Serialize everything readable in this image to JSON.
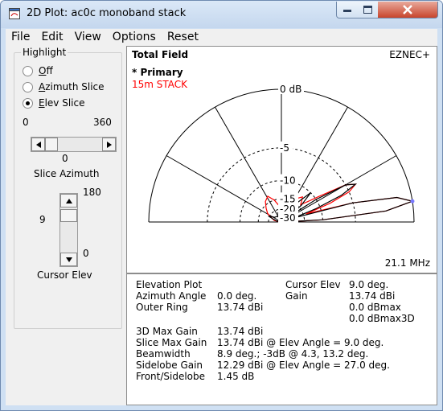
{
  "window": {
    "title": "2D Plot: ac0c monoband stack"
  },
  "menu": [
    "File",
    "Edit",
    "View",
    "Options",
    "Reset"
  ],
  "highlight": {
    "title": "Highlight",
    "options": [
      {
        "label": "Off",
        "underline": "O",
        "rest": "ff",
        "selected": false
      },
      {
        "label": "Azimuth Slice",
        "underline": "A",
        "rest": "zimuth Slice",
        "selected": false
      },
      {
        "label": "Elev Slice",
        "underline": "E",
        "rest": "lev Slice",
        "selected": true
      }
    ]
  },
  "slice_azimuth": {
    "min": "0",
    "max": "360",
    "value": "0",
    "label": "Slice Azimuth",
    "fraction": 0.0
  },
  "cursor_elev": {
    "max": "180",
    "min": "0",
    "value": "9",
    "label": "Cursor Elev",
    "fraction": 0.05
  },
  "plot": {
    "title": "Total Field",
    "brand": "EZNEC+",
    "trace_primary": "* Primary",
    "trace_secondary": "15m STACK",
    "frequency": "21.1 MHz",
    "ring_labels": [
      "0 dB",
      "-5",
      "-10",
      "-15",
      "-20",
      "-30"
    ],
    "colors": {
      "primary": "#000000",
      "secondary": "#ff0000"
    }
  },
  "chart_data": {
    "type": "polar",
    "title": "Total Field",
    "units": "dB",
    "ring_labels": [
      "0 dB",
      "-5",
      "-10",
      "-15",
      "-20",
      "-30"
    ],
    "series": [
      {
        "name": "* Primary",
        "color": "#000000",
        "points": [
          [
            0,
            -40
          ],
          [
            3,
            -10
          ],
          [
            6,
            -2
          ],
          [
            9,
            0
          ],
          [
            12,
            -1
          ],
          [
            15,
            -5
          ],
          [
            18,
            -20
          ],
          [
            21,
            -11
          ],
          [
            24,
            -6
          ],
          [
            27,
            -4
          ],
          [
            30,
            -5
          ],
          [
            33,
            -10
          ],
          [
            36,
            -25
          ],
          [
            40,
            -14
          ],
          [
            45,
            -10
          ],
          [
            50,
            -14
          ],
          [
            55,
            -30
          ],
          [
            65,
            -20
          ],
          [
            80,
            -28
          ],
          [
            90,
            -40
          ],
          [
            100,
            -30
          ],
          [
            110,
            -22
          ],
          [
            120,
            -27
          ],
          [
            130,
            -25
          ],
          [
            145,
            -24
          ],
          [
            155,
            -19
          ],
          [
            160,
            -23
          ],
          [
            170,
            -30
          ],
          [
            180,
            -40
          ]
        ]
      },
      {
        "name": "15m STACK",
        "color": "#ff0000",
        "points": [
          [
            0,
            -40
          ],
          [
            3,
            -10
          ],
          [
            6,
            -2
          ],
          [
            9,
            0
          ],
          [
            12,
            -1
          ],
          [
            15,
            -5
          ],
          [
            18,
            -14
          ],
          [
            21,
            -8
          ],
          [
            24,
            -5
          ],
          [
            27,
            -4
          ],
          [
            30,
            -5
          ],
          [
            34,
            -9
          ],
          [
            38,
            -12
          ],
          [
            42,
            -14
          ],
          [
            46,
            -13
          ],
          [
            50,
            -12
          ],
          [
            55,
            -13
          ],
          [
            62,
            -15
          ],
          [
            70,
            -18
          ],
          [
            80,
            -16
          ],
          [
            90,
            -20
          ],
          [
            98,
            -18
          ],
          [
            108,
            -15
          ],
          [
            118,
            -13
          ],
          [
            128,
            -14
          ],
          [
            138,
            -16
          ],
          [
            148,
            -18
          ],
          [
            158,
            -22
          ],
          [
            168,
            -25
          ],
          [
            180,
            -40
          ]
        ]
      }
    ]
  },
  "info": {
    "elevation_plot": "Elevation Plot",
    "azimuth_angle_label": "Azimuth Angle",
    "azimuth_angle_value": "0.0 deg.",
    "outer_ring_label": "Outer Ring",
    "outer_ring_value": "13.74 dBi",
    "cursor_elev_label": "Cursor Elev",
    "cursor_elev_value": "9.0 deg.",
    "gain_label": "Gain",
    "gain_value": "13.74 dBi",
    "gain_dbmax": "0.0 dBmax",
    "gain_dbmax3d": "0.0 dBmax3D",
    "max_gain_3d_label": "3D Max Gain",
    "max_gain_3d_value": "13.74 dBi",
    "slice_max_gain_label": "Slice Max Gain",
    "slice_max_gain_value": "13.74 dBi @ Elev Angle = 9.0 deg.",
    "beamwidth_label": "Beamwidth",
    "beamwidth_value": "8.9 deg.; -3dB @ 4.3, 13.2 deg.",
    "sidelobe_gain_label": "Sidelobe Gain",
    "sidelobe_gain_value": "12.29 dBi @ Elev Angle = 27.0 deg.",
    "front_sidelobe_label": "Front/Sidelobe",
    "front_sidelobe_value": "1.45 dB"
  }
}
